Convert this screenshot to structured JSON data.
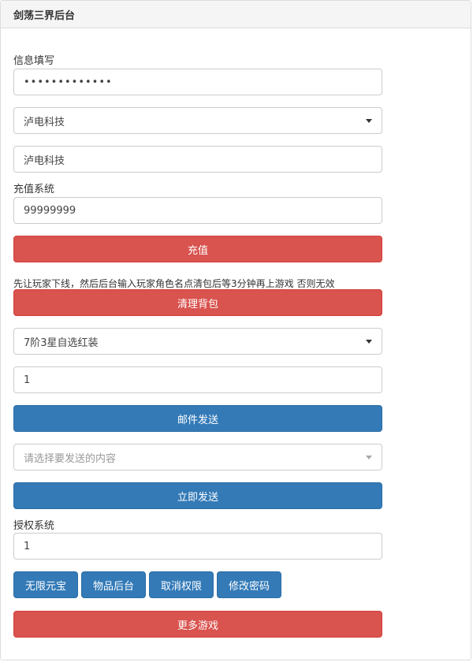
{
  "header": {
    "title": "剑荡三界后台"
  },
  "info": {
    "label": "信息填写",
    "password_mask": "•••••••••••••",
    "server_select": "泸电科技",
    "role_input": "泸电科技"
  },
  "recharge": {
    "label": "充值系统",
    "amount": "99999999",
    "button": "充值",
    "note": "先让玩家下线，然后后台输入玩家角色名点清包后等3分钟再上游戏 否则无效",
    "clear_button": "清理背包"
  },
  "mail": {
    "item_select": "7阶3星自选红装",
    "quantity": "1",
    "send_button": "邮件发送",
    "content_placeholder": "请选择要发送的内容",
    "send_now_button": "立即发送"
  },
  "auth": {
    "label": "授权系统",
    "value": "1",
    "buttons": [
      "无限元宝",
      "物品后台",
      "取消权限",
      "修改密码"
    ]
  },
  "more_games": "更多游戏",
  "colors": {
    "red": "#d9534f",
    "blue": "#337ab7"
  }
}
